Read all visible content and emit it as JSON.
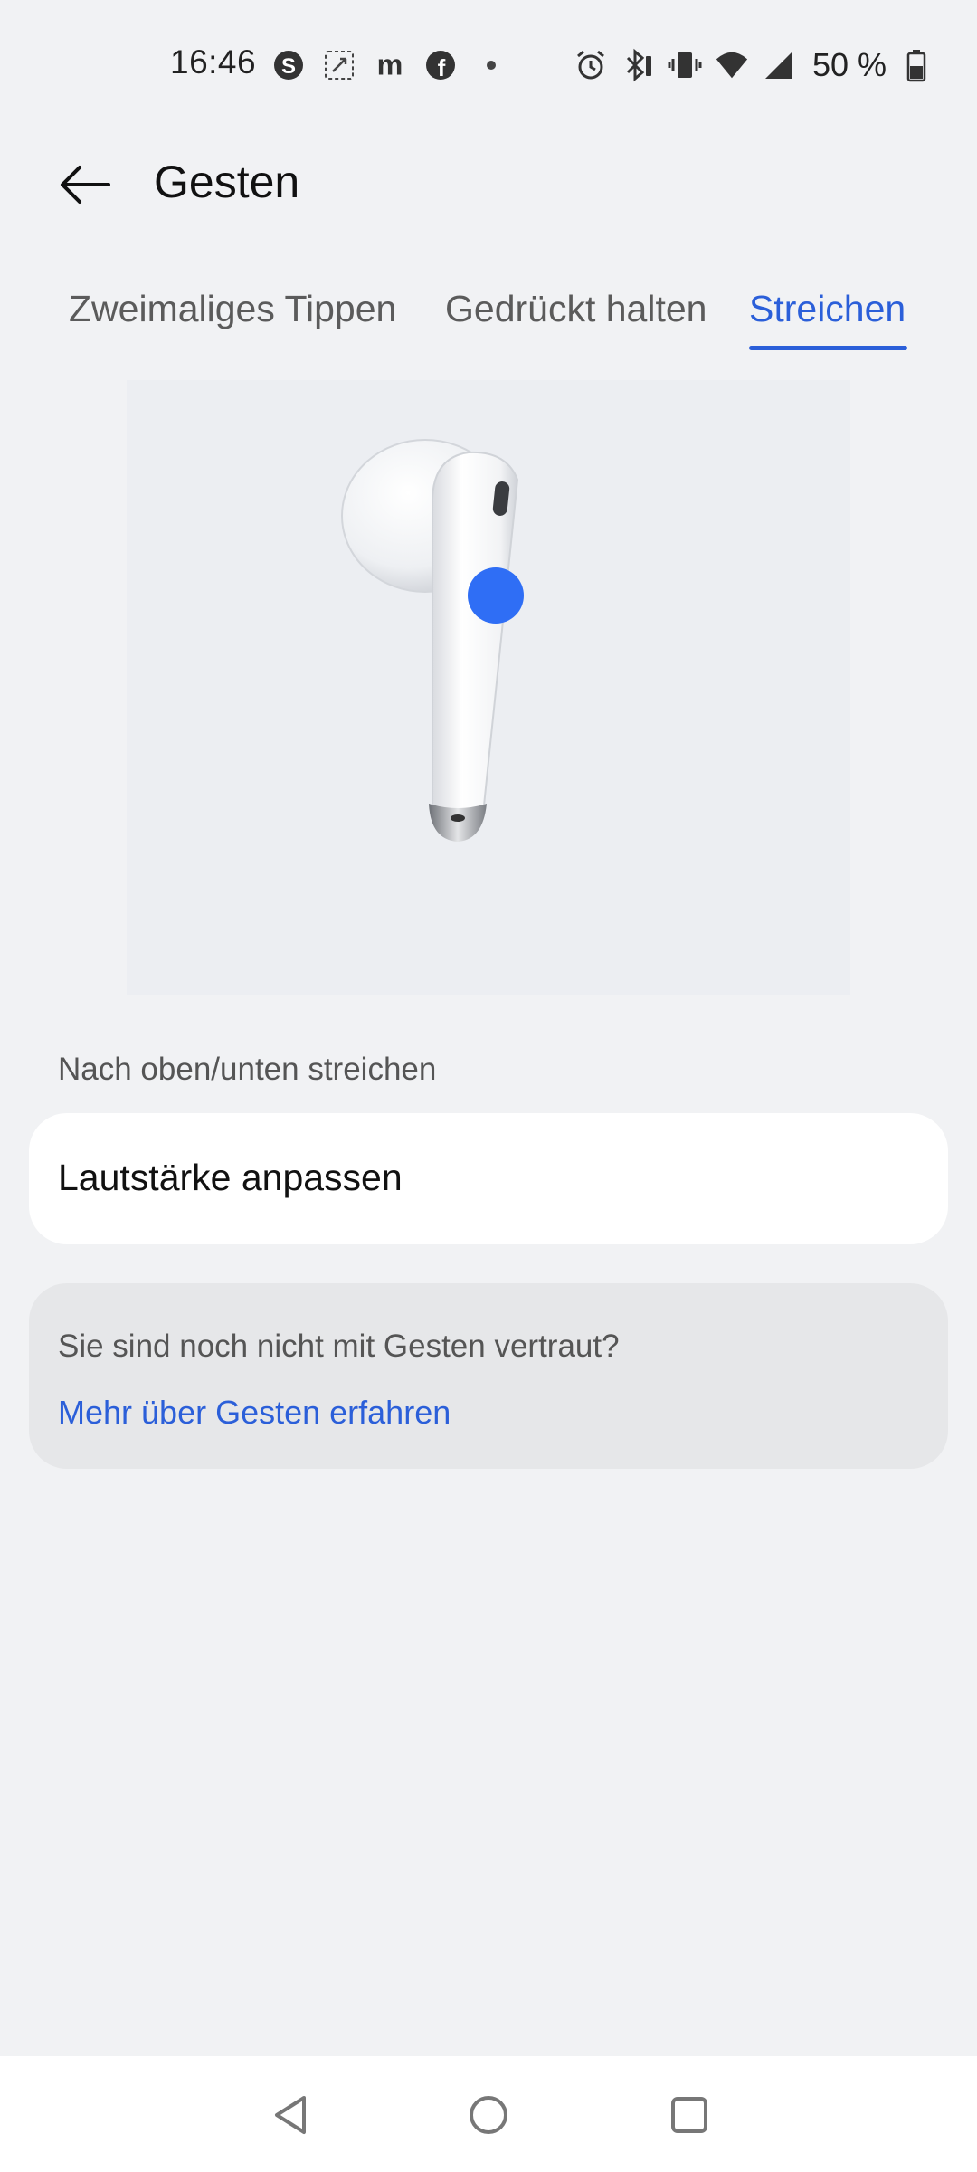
{
  "status_bar": {
    "time": "16:46",
    "battery_text": "50 %",
    "left_icons": [
      "skype-icon",
      "screenshot-icon",
      "m-app-icon",
      "facebook-icon",
      "dot-icon"
    ],
    "right_icons": [
      "alarm-icon",
      "bluetooth-icon",
      "vibrate-icon",
      "wifi-icon",
      "signal-icon",
      "battery-icon"
    ]
  },
  "header": {
    "title": "Gesten"
  },
  "tabs": [
    {
      "label": "Zweimaliges Tippen",
      "active": false
    },
    {
      "label": "Gedrückt halten",
      "active": false
    },
    {
      "label": "Streichen",
      "active": true
    }
  ],
  "section": {
    "label": "Nach oben/unten streichen",
    "value": "Lautstärke anpassen"
  },
  "info": {
    "text": "Sie sind noch nicht mit Gesten vertraut?",
    "link": "Mehr über Gesten erfahren"
  },
  "colors": {
    "accent": "#2b5fd9",
    "background": "#f1f2f4",
    "touch_indicator": "#2f6ef5"
  }
}
